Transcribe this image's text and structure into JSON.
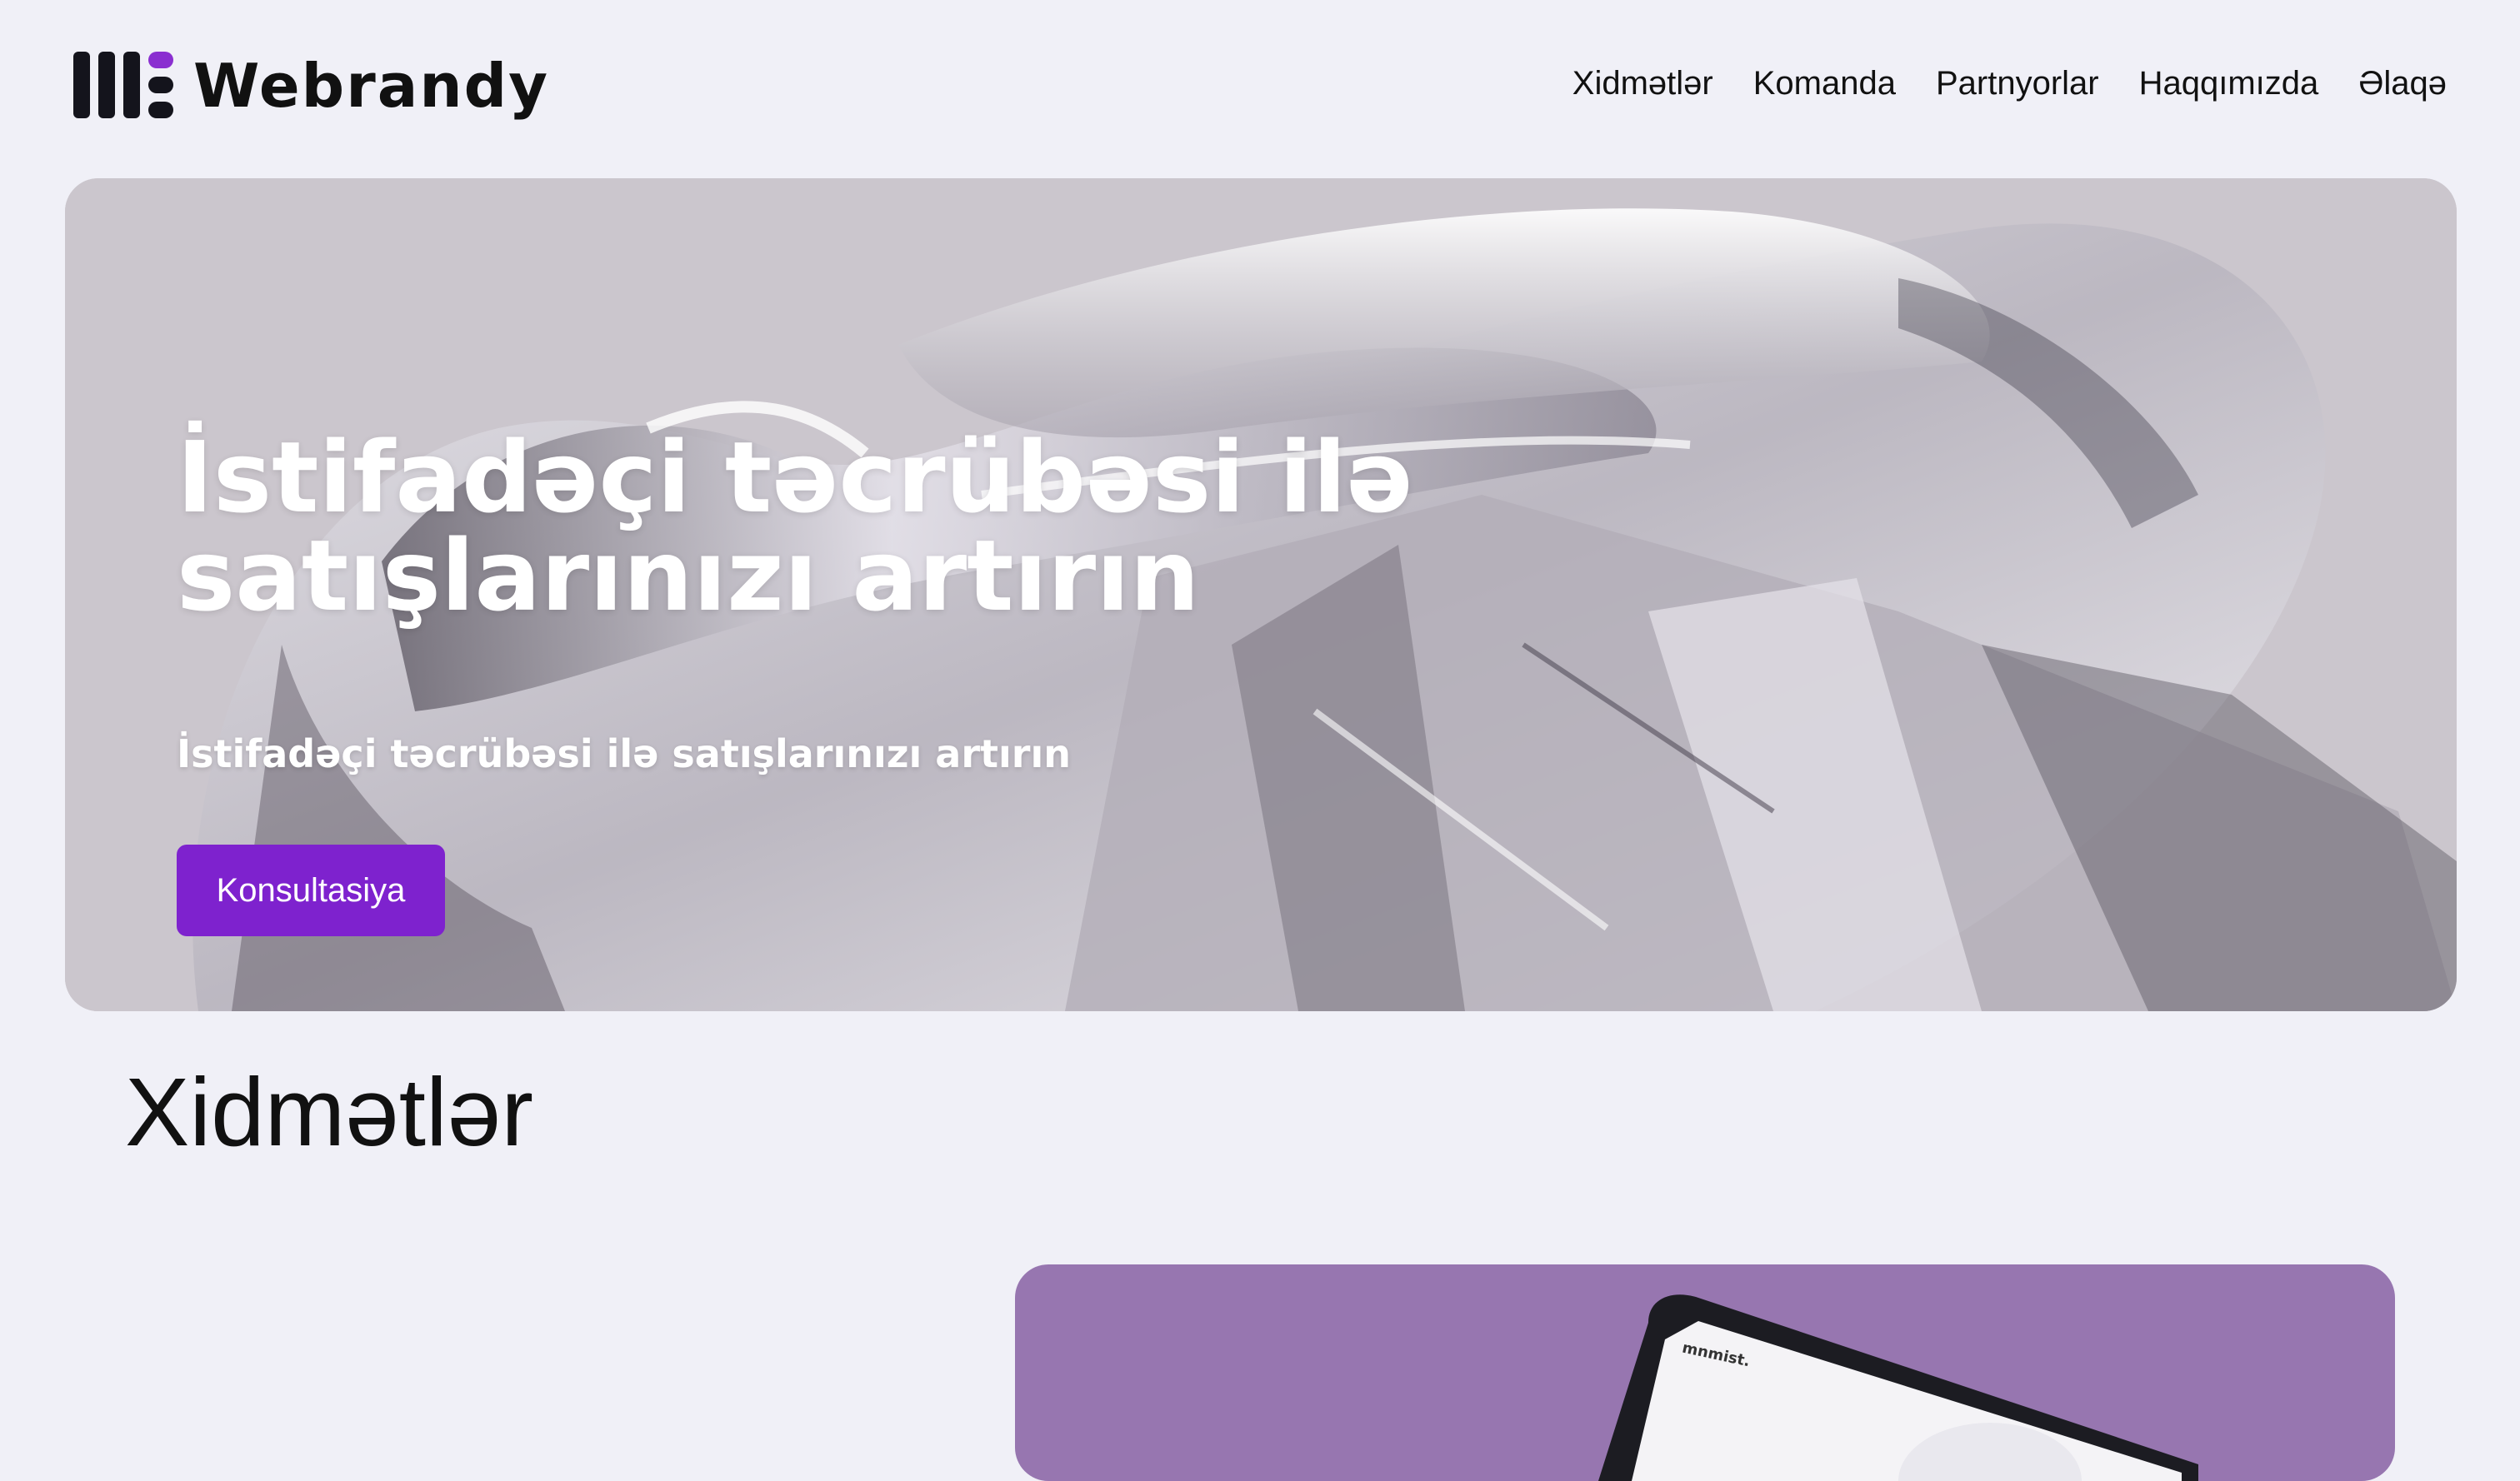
{
  "header": {
    "logo_text": "Webrandy",
    "nav": [
      {
        "label": "Xidmətlər"
      },
      {
        "label": "Komanda"
      },
      {
        "label": "Partnyorlar"
      },
      {
        "label": "Haqqımızda"
      },
      {
        "label": "Əlaqə"
      }
    ]
  },
  "hero": {
    "title": "İstifadəçi təcrübəsi ilə satışlarınızı artırın",
    "subtitle": "İstifadəçi təcrübəsi ilə satışlarınızı artırın",
    "cta_label": "Konsultasiya"
  },
  "services": {
    "title": "Xidmətlər",
    "card_brand": "mnmist."
  },
  "colors": {
    "page_bg": "#f0f0f7",
    "accent": "#7e22ce",
    "card_bg": "#9776b0",
    "text": "#111111"
  }
}
